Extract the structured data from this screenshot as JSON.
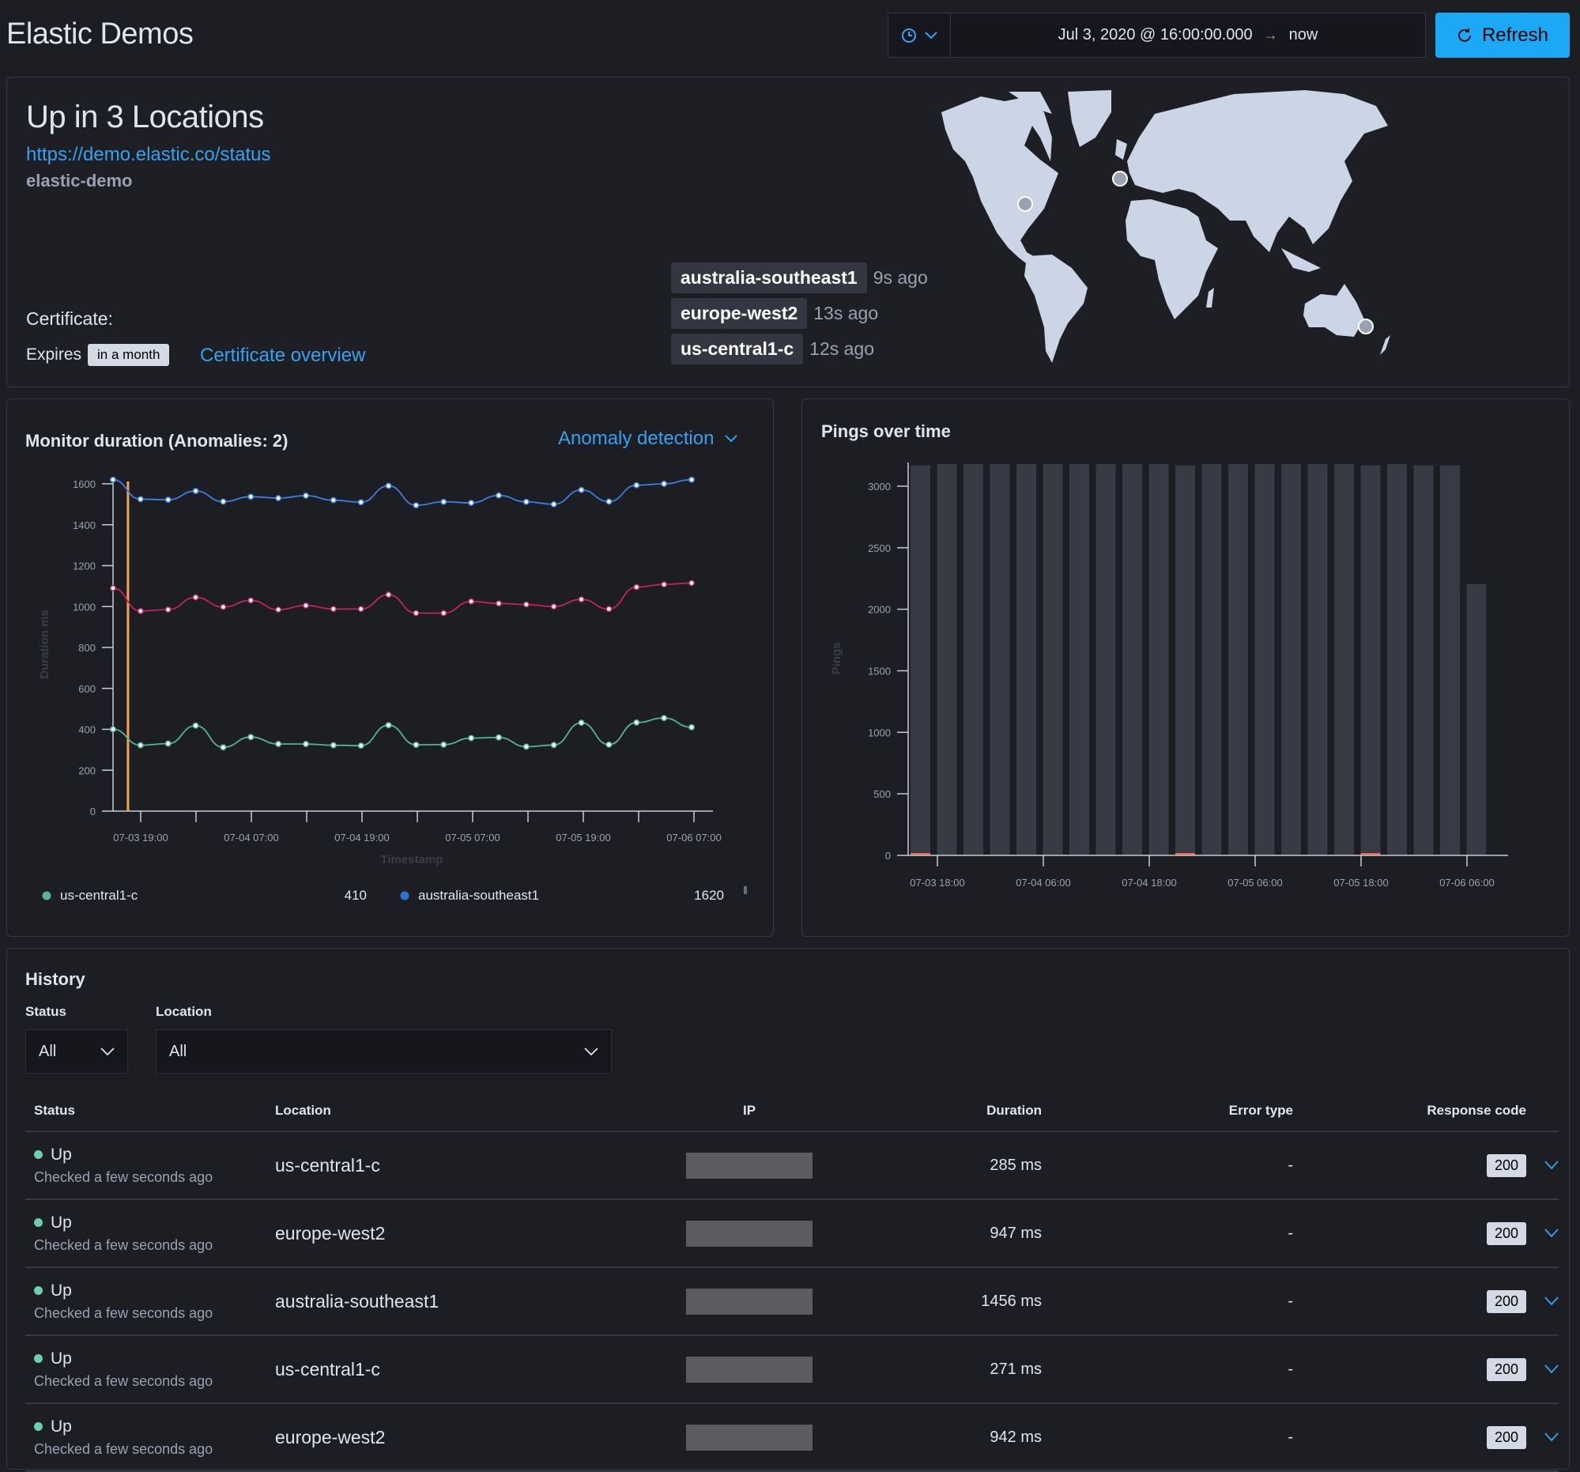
{
  "header": {
    "title": "Elastic Demos",
    "date_start": "Jul 3, 2020 @ 16:00:00.000",
    "date_arrow": "→",
    "date_end": "now",
    "quick_select_icon": "clock-icon",
    "refresh_label": "Refresh",
    "refresh_icon": "refresh-icon"
  },
  "status_panel": {
    "title": "Up in 3 Locations",
    "url": "https://demo.elastic.co/status",
    "monitor_id": "elastic-demo",
    "certificate_label": "Certificate:",
    "expires_label": "Expires",
    "expires_badge": "in a month",
    "certificate_link": "Certificate overview",
    "locations": [
      {
        "name": "australia-southeast1",
        "ago": "9s ago"
      },
      {
        "name": "europe-west2",
        "ago": "13s ago"
      },
      {
        "name": "us-central1-c",
        "ago": "12s ago"
      }
    ],
    "map_markers": [
      "us-central1-c",
      "europe-west2",
      "australia-southeast1"
    ]
  },
  "duration_panel": {
    "title": "Monitor duration (Anomalies: 2)",
    "anomaly_button": "Anomaly detection",
    "legend": [
      {
        "name": "us-central1-c",
        "value": "410",
        "color": "#54b399"
      },
      {
        "name": "australia-southeast1",
        "value": "1620",
        "color": "#2f74d0"
      }
    ]
  },
  "pings_panel": {
    "title": "Pings over time"
  },
  "chart_data": [
    {
      "type": "line",
      "title": "Monitor duration (Anomalies: 2)",
      "xlabel": "Timestamp",
      "ylabel": "Duration ms",
      "ylim": [
        0,
        1600
      ],
      "yticks": [
        0,
        200,
        400,
        600,
        800,
        1000,
        1200,
        1400,
        1600
      ],
      "xtick_labels": [
        "07-03 19:00",
        "07-04 07:00",
        "07-04 19:00",
        "07-05 07:00",
        "07-05 19:00",
        "07-06 07:00"
      ],
      "anomaly_marker_index": 0.6,
      "series": [
        {
          "name": "australia-southeast1",
          "color": "#3d7fe0",
          "values": [
            1620,
            1525,
            1522,
            1565,
            1513,
            1537,
            1530,
            1542,
            1520,
            1510,
            1590,
            1495,
            1512,
            1507,
            1543,
            1512,
            1500,
            1570,
            1513,
            1593,
            1600,
            1620
          ]
        },
        {
          "name": "europe-west2",
          "color": "#c0245d",
          "values": [
            1090,
            978,
            985,
            1045,
            998,
            1030,
            985,
            1005,
            988,
            988,
            1058,
            968,
            968,
            1025,
            1015,
            1010,
            1000,
            1035,
            988,
            1095,
            1108,
            1115
          ]
        },
        {
          "name": "us-central1-c",
          "color": "#54b399",
          "values": [
            400,
            322,
            330,
            418,
            312,
            362,
            328,
            328,
            322,
            320,
            420,
            324,
            325,
            357,
            360,
            315,
            323,
            432,
            325,
            433,
            455,
            410
          ]
        }
      ]
    },
    {
      "type": "bar",
      "title": "Pings over time",
      "xlabel": "",
      "ylabel": "Pings",
      "ylim": [
        0,
        3230
      ],
      "yticks": [
        0,
        500,
        1000,
        1500,
        2000,
        2500,
        3000
      ],
      "xtick_labels": [
        "07-03 18:00",
        "07-04 06:00",
        "07-04 18:00",
        "07-05 06:00",
        "07-05 18:00",
        "07-06 06:00"
      ],
      "series": [
        {
          "name": "up",
          "color": "#383a45",
          "values": [
            3220,
            3230,
            3230,
            3230,
            3230,
            3230,
            3230,
            3230,
            3230,
            3230,
            3220,
            3230,
            3230,
            3230,
            3230,
            3230,
            3230,
            3220,
            3230,
            3220,
            3220,
            2240
          ]
        },
        {
          "name": "down",
          "color": "#e7664c",
          "values": [
            20,
            0,
            0,
            0,
            0,
            0,
            0,
            0,
            0,
            0,
            8,
            0,
            0,
            0,
            0,
            0,
            0,
            12,
            0,
            0,
            0,
            0
          ]
        }
      ]
    }
  ],
  "history": {
    "title": "History",
    "status_filter_label": "Status",
    "status_filter_value": "All",
    "location_filter_label": "Location",
    "location_filter_value": "All",
    "columns": [
      "Status",
      "Location",
      "IP",
      "Duration",
      "Error type",
      "Response code"
    ],
    "rows": [
      {
        "status": "Up",
        "checked": "Checked a few seconds ago",
        "location": "us-central1-c",
        "duration": "285 ms",
        "error": "-",
        "code": "200"
      },
      {
        "status": "Up",
        "checked": "Checked a few seconds ago",
        "location": "europe-west2",
        "duration": "947 ms",
        "error": "-",
        "code": "200"
      },
      {
        "status": "Up",
        "checked": "Checked a few seconds ago",
        "location": "australia-southeast1",
        "duration": "1456 ms",
        "error": "-",
        "code": "200"
      },
      {
        "status": "Up",
        "checked": "Checked a few seconds ago",
        "location": "us-central1-c",
        "duration": "271 ms",
        "error": "-",
        "code": "200"
      },
      {
        "status": "Up",
        "checked": "Checked a few seconds ago",
        "location": "europe-west2",
        "duration": "942 ms",
        "error": "-",
        "code": "200"
      }
    ]
  }
}
